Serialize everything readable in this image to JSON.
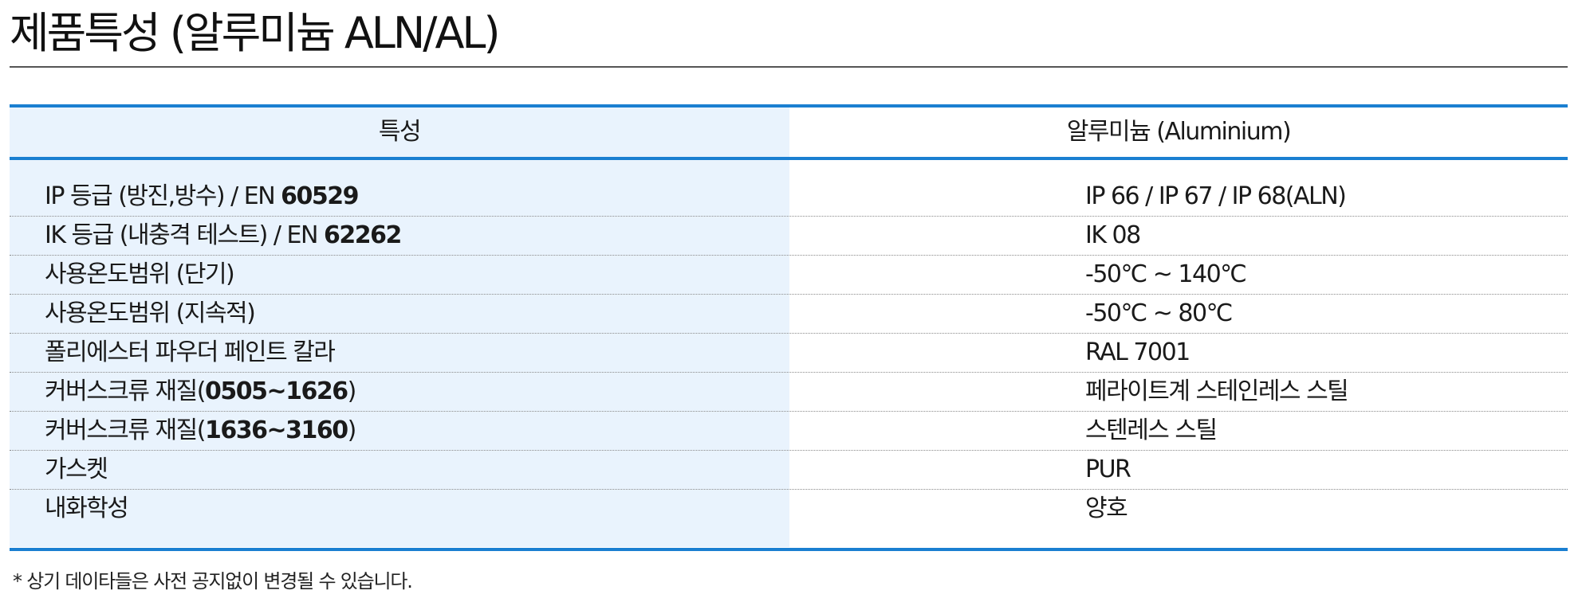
{
  "title": "제품특성 (알루미늄 ALN/AL)",
  "table": {
    "header_left": "특성",
    "header_right": "알루미늄 (Aluminium)",
    "rows": [
      {
        "label": "IP 등급 (방진,방수) / EN ",
        "label_bold": "60529",
        "label_end": "",
        "value": "IP 66 / IP 67 / IP 68(ALN)"
      },
      {
        "label": "IK 등급 (내충격 테스트) / EN ",
        "label_bold": "62262",
        "label_end": "",
        "value": "IK 08"
      },
      {
        "label": "사용온도범위 (단기)",
        "label_bold": "",
        "label_end": "",
        "value": "-50℃ ~ 140℃"
      },
      {
        "label": "사용온도범위 (지속적)",
        "label_bold": "",
        "label_end": "",
        "value": "-50℃ ~ 80℃"
      },
      {
        "label": "폴리에스터 파우더 페인트 칼라",
        "label_bold": "",
        "label_end": "",
        "value": "RAL 7001"
      },
      {
        "label": "커버스크류 재질(",
        "label_bold": "0505~1626",
        "label_end": ")",
        "value": "페라이트계 스테인레스 스틸"
      },
      {
        "label": "커버스크류 재질(",
        "label_bold": "1636~3160",
        "label_end": ")",
        "value": "스텐레스 스틸"
      },
      {
        "label": "가스켓",
        "label_bold": "",
        "label_end": "",
        "value": "PUR"
      },
      {
        "label": "내화학성",
        "label_bold": "",
        "label_end": "",
        "value": "양호"
      }
    ]
  },
  "footnote": "* 상기 데이타들은 사전 공지없이 변경될 수 있습니다.",
  "colors": {
    "accent": "#1a7fd1",
    "left_column_bg": "#e9f3fd"
  }
}
